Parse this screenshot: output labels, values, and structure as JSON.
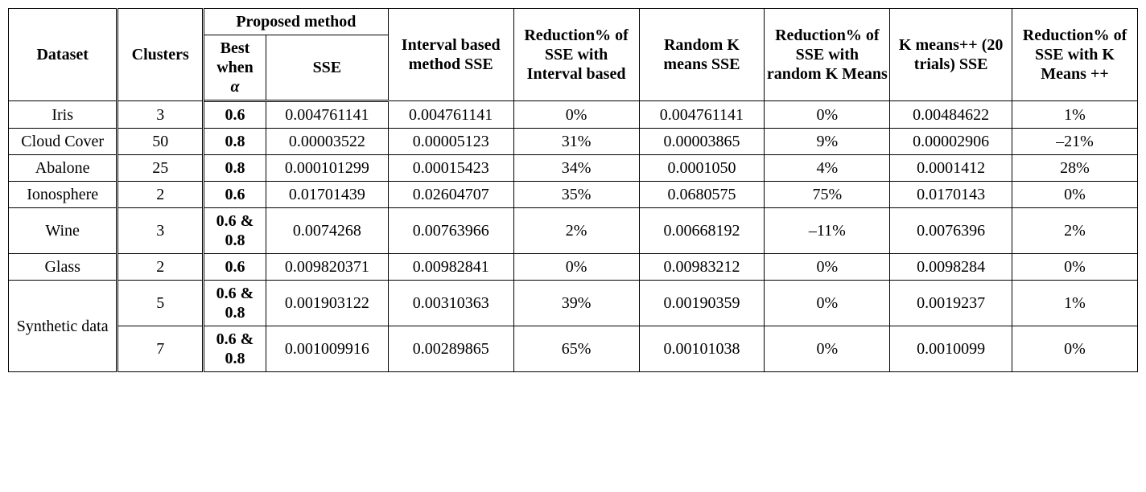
{
  "headers": {
    "dataset": "Dataset",
    "clusters": "Clusters",
    "proposed": "Proposed method",
    "best_alpha_line1": "Best when",
    "best_alpha_sym": "α",
    "sse": "SSE",
    "interval": "Interval based method SSE",
    "red_interval": "Reduction% of SSE with Interval based",
    "random": "Random K means SSE",
    "red_random": "Reduction% of SSE with random K Means",
    "kpp": "K means++ (20 trials) SSE",
    "red_kpp": "Reduction% of SSE with K Means ++"
  },
  "rows": [
    {
      "dataset": "Iris",
      "clusters": "3",
      "alpha": "0.6",
      "sse": "0.004761141",
      "interval": "0.004761141",
      "red_interval": "0%",
      "random": "0.004761141",
      "red_random": "0%",
      "kpp": "0.00484622",
      "red_kpp": "1%"
    },
    {
      "dataset": "Cloud Cover",
      "clusters": "50",
      "alpha": "0.8",
      "sse": "0.00003522",
      "interval": "0.00005123",
      "red_interval": "31%",
      "random": "0.00003865",
      "red_random": "9%",
      "kpp": "0.00002906",
      "red_kpp": "–21%"
    },
    {
      "dataset": "Abalone",
      "clusters": "25",
      "alpha": "0.8",
      "sse": "0.000101299",
      "interval": "0.00015423",
      "red_interval": "34%",
      "random": "0.0001050",
      "red_random": "4%",
      "kpp": "0.0001412",
      "red_kpp": "28%"
    },
    {
      "dataset": "Ionosphere",
      "clusters": "2",
      "alpha": "0.6",
      "sse": "0.01701439",
      "interval": "0.02604707",
      "red_interval": "35%",
      "random": "0.0680575",
      "red_random": "75%",
      "kpp": "0.0170143",
      "red_kpp": "0%"
    },
    {
      "dataset": "Wine",
      "clusters": "3",
      "alpha": "0.6 & 0.8",
      "sse": "0.0074268",
      "interval": "0.00763966",
      "red_interval": "2%",
      "random": "0.00668192",
      "red_random": "–11%",
      "kpp": "0.0076396",
      "red_kpp": "2%"
    },
    {
      "dataset": "Glass",
      "clusters": "2",
      "alpha": "0.6",
      "sse": "0.009820371",
      "interval": "0.00982841",
      "red_interval": "0%",
      "random": "0.00983212",
      "red_random": "0%",
      "kpp": "0.0098284",
      "red_kpp": "0%"
    },
    {
      "dataset": "Synthetic data",
      "clusters": "5",
      "alpha": "0.6 & 0.8",
      "sse": "0.001903122",
      "interval": "0.00310363",
      "red_interval": "39%",
      "random": "0.00190359",
      "red_random": "0%",
      "kpp": "0.0019237",
      "red_kpp": "1%"
    },
    {
      "dataset": "",
      "clusters": "7",
      "alpha": "0.6 & 0.8",
      "sse": "0.001009916",
      "interval": "0.00289865",
      "red_interval": "65%",
      "random": "0.00101038",
      "red_random": "0%",
      "kpp": "0.0010099",
      "red_kpp": "0%"
    }
  ]
}
